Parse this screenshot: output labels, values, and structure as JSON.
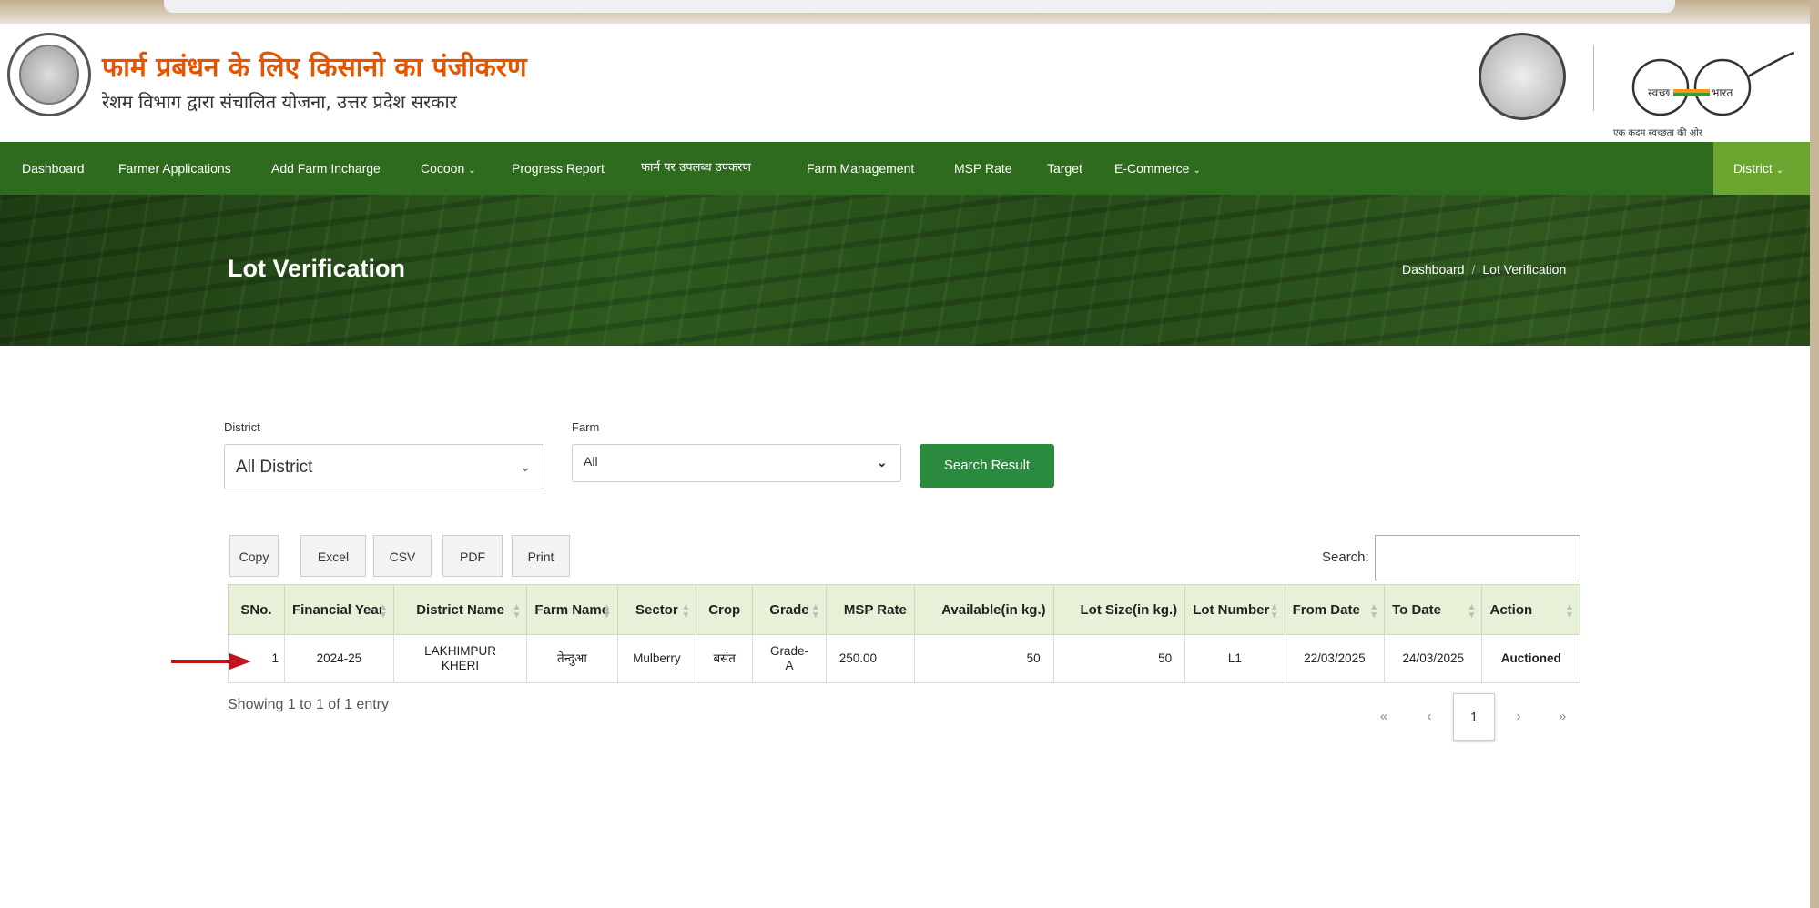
{
  "header": {
    "title": "फार्म प्रबंधन के लिए किसानो का पंजीकरण",
    "subtitle": "रेशम विभाग द्वारा संचालित योजना, उत्तर प्रदेश सरकार",
    "swachh_left": "स्वच्छ",
    "swachh_right": "भारत",
    "swachh_caption": "एक कदम स्वच्छता की ओर"
  },
  "nav": {
    "items": [
      {
        "label": "Dashboard"
      },
      {
        "label": "Farmer Applications"
      },
      {
        "label": "Add Farm Incharge"
      },
      {
        "label": "Cocoon",
        "dropdown": true
      },
      {
        "label": "Progress Report"
      },
      {
        "label": "फार्म पर उपलब्ध उपकरण"
      },
      {
        "label": "Farm Management"
      },
      {
        "label": "MSP Rate"
      },
      {
        "label": "Target"
      },
      {
        "label": "E-Commerce",
        "dropdown": true
      }
    ],
    "district_label": "District",
    "chevron": "⌄"
  },
  "banner": {
    "title": "Lot Verification",
    "breadcrumb": [
      "Dashboard",
      "Lot Verification"
    ],
    "breadcrumb_sep": "/"
  },
  "filters": {
    "district_label": "District",
    "district_value": "All District",
    "farm_label": "Farm",
    "farm_value": "All",
    "search_button": "Search Result"
  },
  "table_tools": {
    "buttons": [
      "Copy",
      "Excel",
      "CSV",
      "PDF",
      "Print"
    ],
    "search_label": "Search:",
    "search_value": ""
  },
  "table": {
    "columns": [
      "SNo.",
      "Financial Year",
      "District Name",
      "Farm Name",
      "Sector",
      "Crop",
      "Grade",
      "MSP Rate",
      "Available(in kg.)",
      "Lot Size(in kg.)",
      "Lot Number",
      "From Date",
      "To Date",
      "Action"
    ],
    "rows": [
      [
        "1",
        "2024-25",
        "LAKHIMPUR KHERI",
        "तेन्दुआ",
        "Mulberry",
        "बसंत",
        "Grade-A",
        "250.00",
        "50",
        "50",
        "L1",
        "22/03/2025",
        "24/03/2025",
        "Auctioned"
      ]
    ]
  },
  "footer": {
    "info": "Showing 1 to 1 of 1 entry",
    "pagination": {
      "first": "«",
      "prev": "‹",
      "current": "1",
      "next": "›",
      "last": "»"
    }
  },
  "colors": {
    "nav_bg": "#2f6b1f",
    "nav_district_bg": "#6aa52f",
    "title_orange": "#e35500",
    "search_button": "#2a8a3e",
    "header_row": "#e6f1d8",
    "action_green": "#1e8a2e",
    "annotation_arrow": "#c0151b"
  },
  "icons": {
    "dropdown": "chevron-down-icon",
    "sort": "sort-icon",
    "annotation": "red-arrow-icon"
  }
}
